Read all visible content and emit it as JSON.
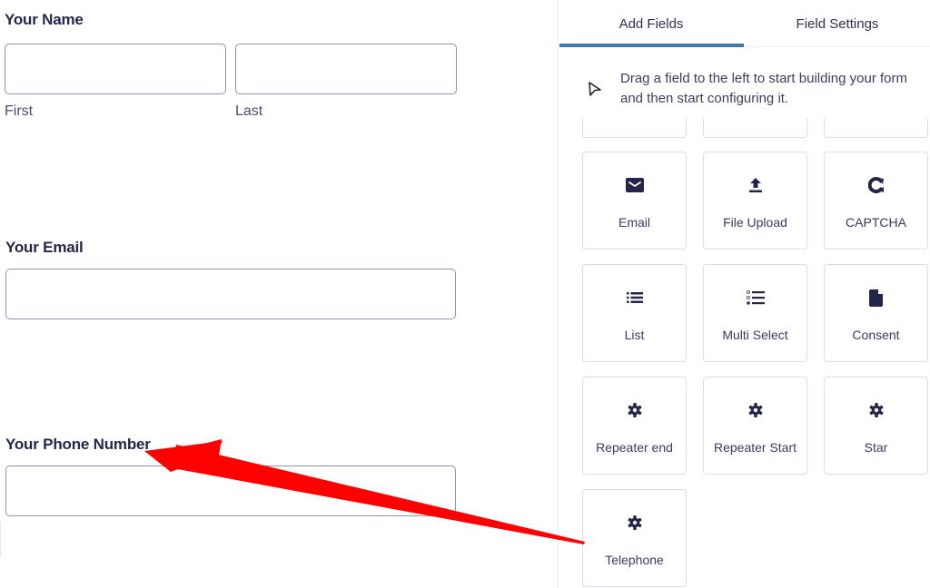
{
  "form": {
    "name_field": {
      "label": "Your Name",
      "first": {
        "value": "",
        "sublabel": "First"
      },
      "last": {
        "value": "",
        "sublabel": "Last"
      }
    },
    "email_field": {
      "label": "Your Email",
      "value": ""
    },
    "phone_field": {
      "label": "Your Phone Number",
      "value": ""
    }
  },
  "sidebar": {
    "tabs": [
      {
        "label": "Add Fields",
        "active": true
      },
      {
        "label": "Field Settings",
        "active": false
      }
    ],
    "accent_color": "#3e7ba8",
    "hint": {
      "icon": "cursor-pointer-icon",
      "text": "Drag a field to the left to start building your form and then start configuring it."
    },
    "field_tiles": [
      {
        "label": "Email",
        "icon": "envelope-icon"
      },
      {
        "label": "File Upload",
        "icon": "upload-icon"
      },
      {
        "label": "CAPTCHA",
        "icon": "refresh-icon"
      },
      {
        "label": "List",
        "icon": "list-icon"
      },
      {
        "label": "Multi Select",
        "icon": "multi-select-list-icon"
      },
      {
        "label": "Consent",
        "icon": "document-icon"
      },
      {
        "label": "Repeater end",
        "icon": "gear-icon"
      },
      {
        "label": "Repeater Start",
        "icon": "gear-icon"
      },
      {
        "label": "Star",
        "icon": "gear-icon"
      },
      {
        "label": "Telephone",
        "icon": "gear-icon"
      }
    ]
  },
  "annotation": {
    "type": "arrow",
    "color": "#ff0000",
    "from": "Telephone tile",
    "to": "Your Phone Number label"
  }
}
